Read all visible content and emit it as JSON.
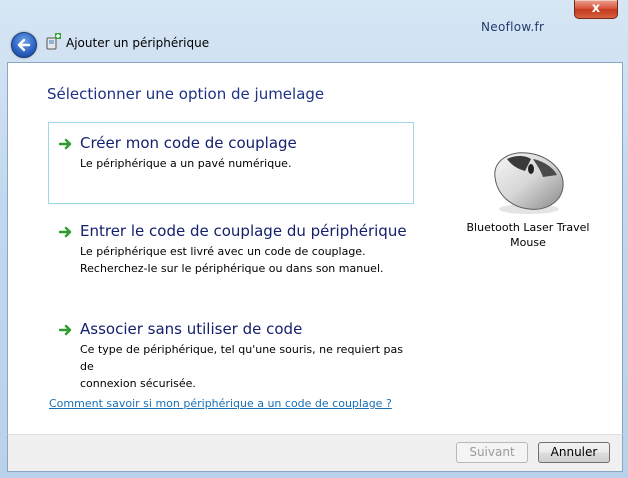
{
  "window": {
    "title": "Ajouter un périphérique",
    "close_label": "x",
    "watermark": "Neoflow.fr"
  },
  "main": {
    "heading": "Sélectionner une option de jumelage",
    "options": [
      {
        "title": "Créer mon code de couplage",
        "desc": [
          "Le périphérique a un pavé numérique."
        ]
      },
      {
        "title": "Entrer le code de couplage du périphérique",
        "desc": [
          "Le périphérique est livré avec un code de couplage.",
          "Recherchez-le sur le périphérique ou dans son manuel."
        ]
      },
      {
        "title": "Associer sans utiliser de code",
        "desc": [
          "Ce type de périphérique, tel qu'une souris, ne requiert pas de",
          "connexion sécurisée."
        ]
      }
    ],
    "help_link": "Comment savoir si mon périphérique a un code de couplage ?",
    "device": {
      "name_line1": "Bluetooth Laser Travel",
      "name_line2": "Mouse",
      "icon": "mouse-icon"
    }
  },
  "footer": {
    "next_label": "Suivant",
    "cancel_label": "Annuler"
  },
  "colors": {
    "heading": "#1e3287",
    "option_title": "#14206e",
    "link": "#1a6fb3",
    "arrow": "#2e9c2e"
  }
}
